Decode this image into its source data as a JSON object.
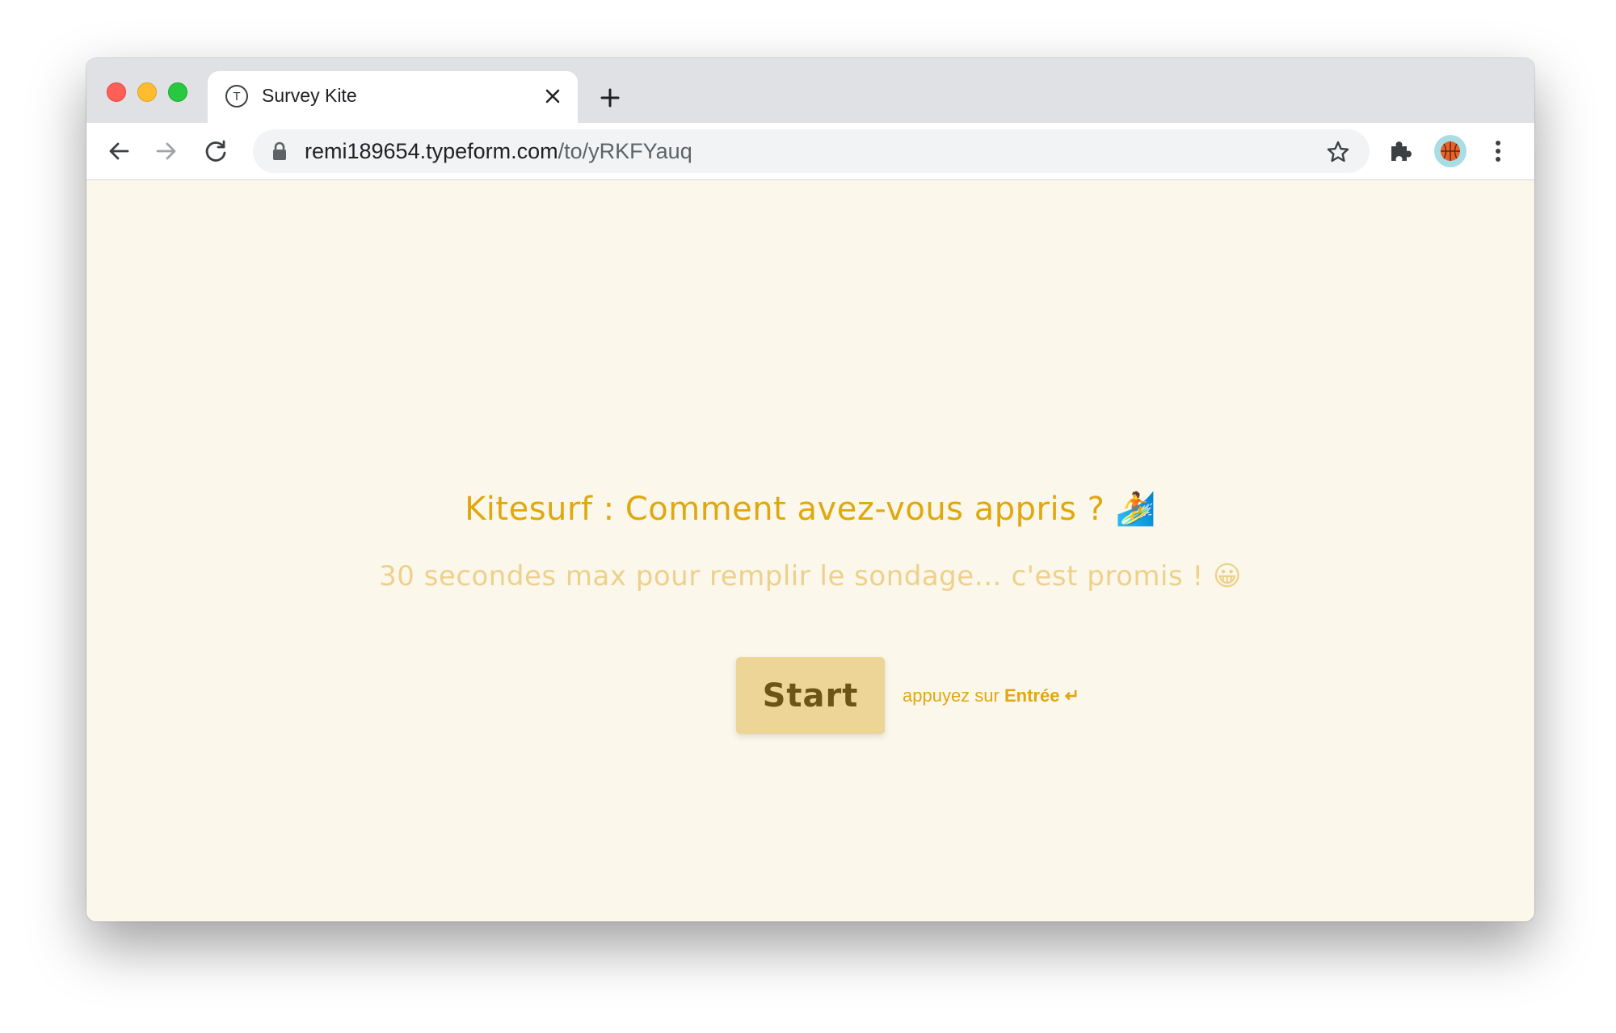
{
  "browser": {
    "tab": {
      "favicon_letter": "T",
      "title": "Survey Kite"
    },
    "address": {
      "host": "remi189654.typeform.com",
      "path": "/to/yRKFYauq"
    }
  },
  "icons": {
    "traffic_lights": [
      "close-traffic-light",
      "minimize-traffic-light",
      "zoom-traffic-light"
    ],
    "tab_close": "close-icon",
    "new_tab": "plus-icon",
    "back": "arrow-left-icon",
    "forward": "arrow-right-icon",
    "reload": "reload-icon",
    "lock": "lock-icon",
    "bookmark": "star-icon",
    "extensions": "puzzle-icon",
    "profile": "basketball-avatar-icon",
    "menu": "more-vertical-icon"
  },
  "form": {
    "title": "Kitesurf : Comment avez-vous appris ?",
    "title_emoji": "🏄",
    "subtitle": "30 secondes max pour remplir le sondage… c'est promis !",
    "subtitle_emoji": "😀",
    "start_label": "Start",
    "hint_prefix": "appuyez sur",
    "hint_key": "Entrée",
    "hint_symbol": "↵"
  },
  "colors": {
    "page_background": "#fbf7eb",
    "accent": "#e0a80f",
    "subtitle": "#edd18b",
    "button_background": "#edd598",
    "button_text": "#6b5416"
  }
}
